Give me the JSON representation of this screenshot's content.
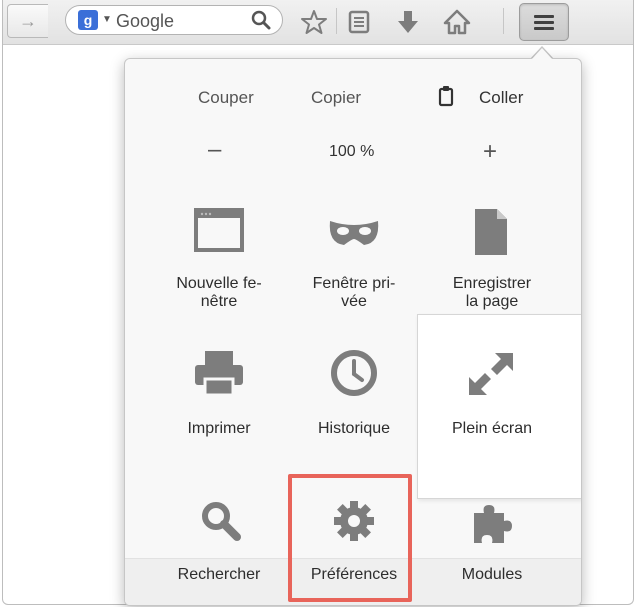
{
  "toolbar": {
    "back_icon": "arrow-right-icon",
    "search": {
      "engine_icon": "g",
      "placeholder": "Google"
    },
    "icons": [
      "star-icon",
      "reader-icon",
      "download-icon",
      "home-icon",
      "menu-icon"
    ]
  },
  "menu": {
    "edit": {
      "cut": "Couper",
      "copy": "Copier",
      "paste": "Coller"
    },
    "zoom": {
      "minus": "–",
      "level": "100 %",
      "plus": "+"
    },
    "tiles": [
      {
        "label": "Nouvelle fe-\nnêtre",
        "icon": "window-icon"
      },
      {
        "label": "Fenêtre pri-\nvée",
        "icon": "mask-icon"
      },
      {
        "label": "Enregistrer\nla page",
        "icon": "page-icon"
      },
      {
        "label": "Imprimer",
        "icon": "printer-icon"
      },
      {
        "label": "Historique",
        "icon": "clock-icon"
      },
      {
        "label": "Plein écran",
        "icon": "expand-icon"
      },
      {
        "label": "Rechercher",
        "icon": "search-icon"
      },
      {
        "label": "Préférences",
        "icon": "gear-icon"
      },
      {
        "label": "Modules",
        "icon": "puzzle-icon"
      }
    ],
    "highlight_color": "#e8645a"
  }
}
